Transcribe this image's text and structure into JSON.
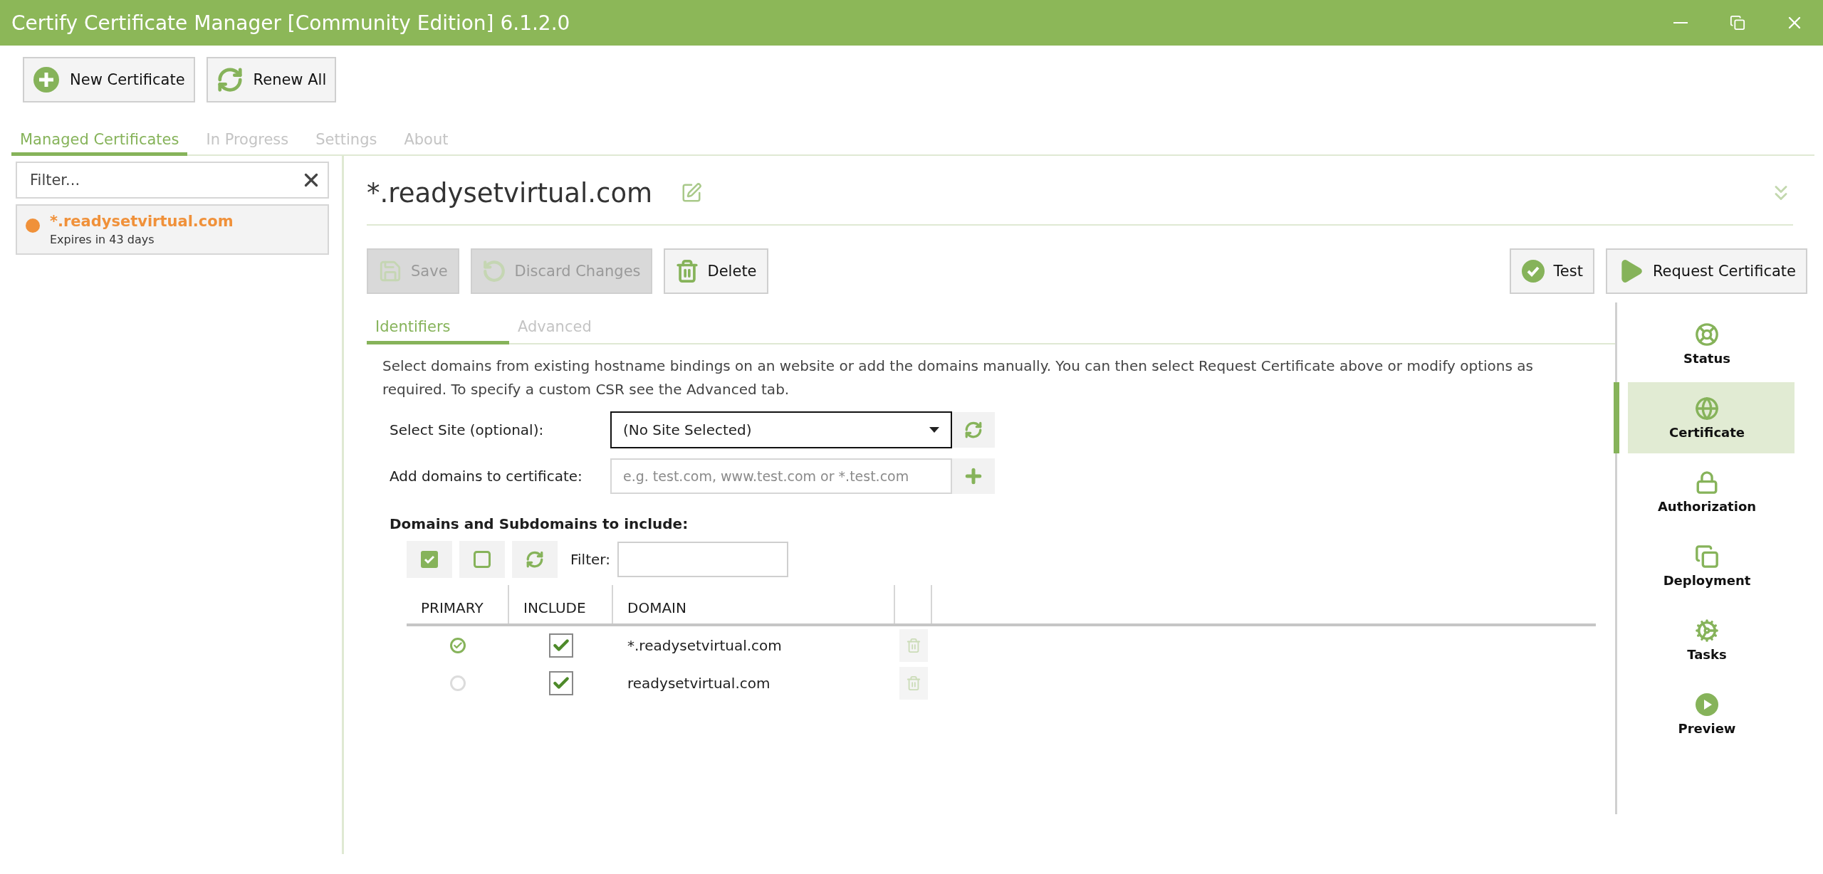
{
  "window": {
    "title": "Certify Certificate Manager [Community Edition] 6.1.2.0"
  },
  "toolbar": [
    {
      "kind": "add",
      "label": "New Certificate"
    },
    {
      "kind": "renew",
      "label": "Renew All"
    }
  ],
  "main_tabs": [
    {
      "label": "Managed Certificates",
      "selected": true
    },
    {
      "label": "In Progress",
      "selected": false
    },
    {
      "label": "Settings",
      "selected": false
    },
    {
      "label": "About",
      "selected": false
    }
  ],
  "sidebar": {
    "filter": {
      "placeholder": "Filter..."
    },
    "items": [
      {
        "name": "*.readysetvirtual.com",
        "subtitle": "Expires in 43 days",
        "color": "#f0913a",
        "selected": true
      }
    ]
  },
  "detail": {
    "title": "*.readysetvirtual.com",
    "actions": [
      {
        "kind": "save",
        "label": "Save",
        "disabled": true
      },
      {
        "kind": "discard",
        "label": "Discard Changes",
        "disabled": true
      },
      {
        "kind": "delete",
        "label": "Delete",
        "disabled": false
      }
    ],
    "run_actions": [
      {
        "kind": "test",
        "label": "Test"
      },
      {
        "kind": "request",
        "label": "Request Certificate"
      }
    ],
    "tabs": [
      {
        "label": "Identifiers",
        "selected": true
      },
      {
        "label": "Advanced",
        "selected": false
      }
    ],
    "description": "Select domains from existing hostname bindings on an website or add the domains manually. You can then select Request Certificate above or modify options as required. To specify a custom CSR see the Advanced tab.",
    "select_site": {
      "label": "Select Site (optional):",
      "value": "(No Site Selected)"
    },
    "add_domains": {
      "label": "Add domains to certificate:",
      "placeholder": "e.g. test.com, www.test.com or *.test.com"
    },
    "domains_heading": "Domains and Subdomains to include:",
    "domain_filter": {
      "label": "Filter:"
    },
    "table": {
      "columns": [
        "PRIMARY",
        "INCLUDE",
        "DOMAIN"
      ],
      "rows": [
        {
          "primary": true,
          "include": true,
          "domain": "*.readysetvirtual.com"
        },
        {
          "primary": false,
          "include": true,
          "domain": "readysetvirtual.com"
        }
      ]
    }
  },
  "nav": [
    {
      "kind": "status",
      "label": "Status",
      "selected": false
    },
    {
      "kind": "certificate",
      "label": "Certificate",
      "selected": true
    },
    {
      "kind": "authorization",
      "label": "Authorization",
      "selected": false
    },
    {
      "kind": "deployment",
      "label": "Deployment",
      "selected": false
    },
    {
      "kind": "tasks",
      "label": "Tasks",
      "selected": false
    },
    {
      "kind": "preview",
      "label": "Preview",
      "selected": false
    }
  ]
}
